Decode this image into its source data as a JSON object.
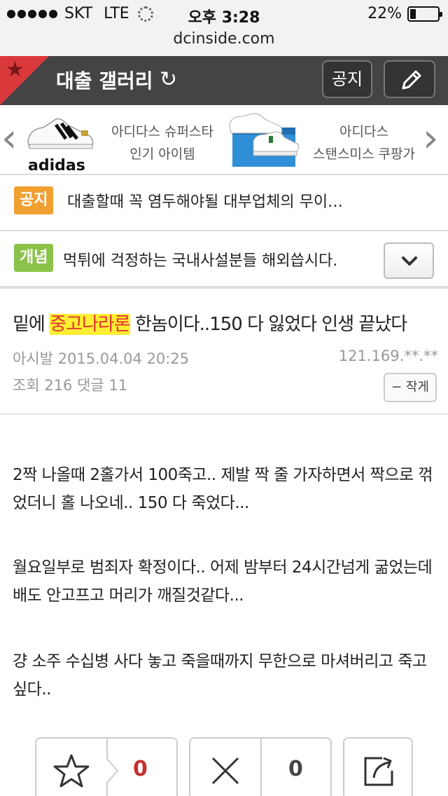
{
  "status": {
    "carrier": "SKT",
    "network": "LTE",
    "time": "오후 3:28",
    "battery": "22%",
    "battery_level": 0.22
  },
  "url": "dcinside.com",
  "gallery": {
    "title": "대출 갤러리",
    "notice_button": "공지",
    "write_icon": "pencil-icon"
  },
  "ad": {
    "brand": "adidas",
    "item1_line1": "아디다스 슈퍼스타",
    "item1_line2": "인기 아이템",
    "item2_line1": "아디다스",
    "item2_line2": "스탠스미스 쿠팡가"
  },
  "notices": [
    {
      "tag": "공지",
      "text": "대출할때 꼭 염두해야될 대부업체의 무이…"
    },
    {
      "tag": "개념",
      "text": "먹튀에 걱정하는 국내사설분들 해외씁시다."
    }
  ],
  "post": {
    "title_before": "밑에 ",
    "title_highlight": "중고나라론",
    "title_after": " 한놈이다..150 다 잃었다 인생 끝났다",
    "author": "아시발",
    "date": "2015.04.04 20:25",
    "ip": "121.169.**.**",
    "views_label": "조회",
    "views": "216",
    "comments_label": "댓글",
    "comments": "11",
    "author_button": "작게",
    "paragraphs": [
      "2짝 나올때 2홀가서 100죽고.. 제발 짝 줄 가자하면서 짝으로 꺾었더니 홀 나오네.. 150 다 죽었다...",
      "월요일부로 범죄자 확정이다.. 어제 밤부터 24시간넘게 굶었는데 배도 안고프고 머리가 깨질것같다...",
      "걍 소주 수십병 사다 놓고 죽을때까지 무한으로 마셔버리고 죽고싶다.."
    ]
  },
  "actions": {
    "recommend_count": "0",
    "nonrecommend_count": "0"
  },
  "colors": {
    "header_bg": "#444444",
    "corner_red": "#d9393b",
    "notice_orange": "#f0a030",
    "concept_green": "#8bc34a",
    "highlight_yellow": "#ffee33",
    "highlight_red": "#e03030"
  }
}
